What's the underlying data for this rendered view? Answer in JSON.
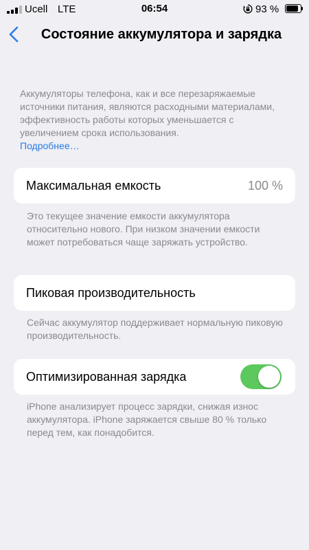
{
  "status_bar": {
    "carrier": "Ucell",
    "network": "LTE",
    "time": "06:54",
    "battery_percent": "93 %",
    "battery_level": 0.93,
    "signal_bars_filled": 3,
    "signal_bars_total": 4,
    "icons": {
      "signal": "cellular-signal-icon",
      "orientation_lock": "orientation-lock-icon",
      "battery": "battery-icon"
    }
  },
  "nav": {
    "back_icon": "chevron-left-icon",
    "title": "Состояние аккумулятора и зарядка"
  },
  "intro": {
    "text": "Аккумуляторы телефона, как и все перезаряжаемые источники питания, являются расходными материалами, эффективность работы которых уменьшается с увеличением срока использования.",
    "link": "Подробнее…"
  },
  "maximum_capacity": {
    "label": "Максимальная емкость",
    "value": "100 %",
    "footnote": "Это текущее значение емкости аккумулятора относительно нового. При низком значении емкости может потребоваться чаще заряжать устройство."
  },
  "peak_performance": {
    "label": "Пиковая производительность",
    "footnote": "Сейчас аккумулятор поддерживает нормальную пиковую производительность."
  },
  "optimized_charging": {
    "label": "Оптимизированная зарядка",
    "enabled": true,
    "footnote": "iPhone анализирует процесс зарядки, снижая износ аккумулятора. iPhone заряжается свыше 80 % только перед тем, как понадобится."
  },
  "colors": {
    "background": "#efeff4",
    "card": "#ffffff",
    "secondary_text": "#8a8a8e",
    "link": "#2a7be4",
    "toggle_on": "#5cc85d"
  }
}
